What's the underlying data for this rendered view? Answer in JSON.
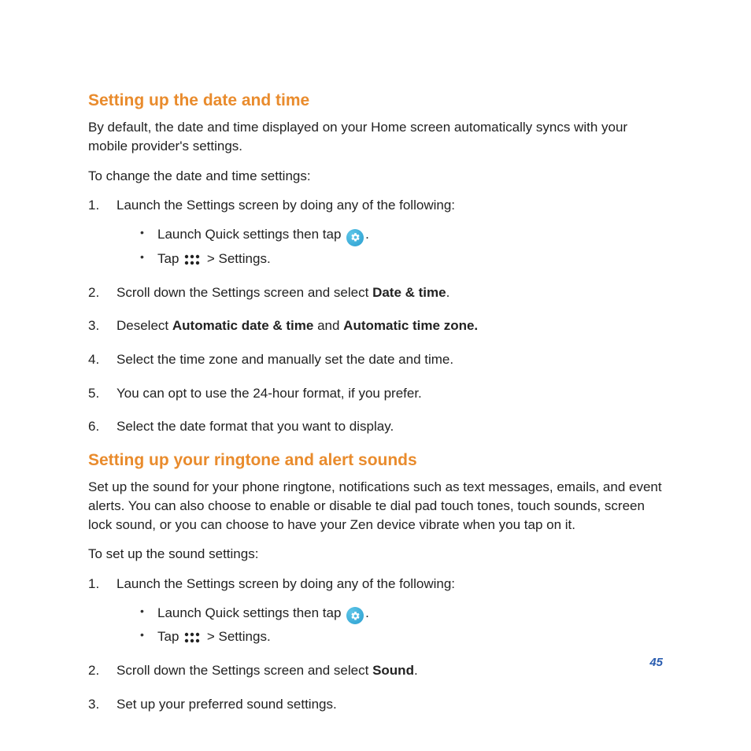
{
  "section1": {
    "heading": "Setting up the date and time",
    "intro": "By default, the date and time displayed on your Home screen automatically syncs with your mobile provider's settings.",
    "lead": "To change the date and time settings:",
    "step1_num": "1.",
    "step1_text": "Launch the Settings screen by doing any of the following:",
    "step1_sub1_a": "Launch Quick settings then tap ",
    "step1_sub1_b": ".",
    "step1_sub2_a": "Tap ",
    "step1_sub2_b": " > Settings.",
    "step2_num": "2.",
    "step2_a": "Scroll down the Settings screen and select ",
    "step2_bold": "Date & time",
    "step2_b": ".",
    "step3_num": "3.",
    "step3_a": "Deselect ",
    "step3_bold1": "Automatic date & time",
    "step3_mid": " and ",
    "step3_bold2": "Automatic time zone.",
    "step4_num": "4.",
    "step4_text": "Select the time zone and manually set the date and time.",
    "step5_num": "5.",
    "step5_text": "You can opt to use the 24-hour format, if you prefer.",
    "step6_num": "6.",
    "step6_text": "Select the date format that you want to display."
  },
  "section2": {
    "heading": "Setting up your ringtone and alert sounds",
    "intro": "Set up the sound for your phone ringtone, notifications such as text messages, emails, and event alerts. You can also choose to enable or disable te dial pad touch tones, touch sounds, screen lock sound, or you can choose to have your Zen device vibrate when you tap on it.",
    "lead": "To set up the sound settings:",
    "step1_num": "1.",
    "step1_text": "Launch the Settings screen by doing any of the following:",
    "step1_sub1_a": "Launch Quick settings then tap ",
    "step1_sub1_b": ".",
    "step1_sub2_a": "Tap ",
    "step1_sub2_b": " > Settings.",
    "step2_num": "2.",
    "step2_a": "Scroll down the Settings screen and select ",
    "step2_bold": "Sound",
    "step2_b": ".",
    "step3_num": "3.",
    "step3_text": "Set up your preferred sound settings."
  },
  "page_number": "45"
}
